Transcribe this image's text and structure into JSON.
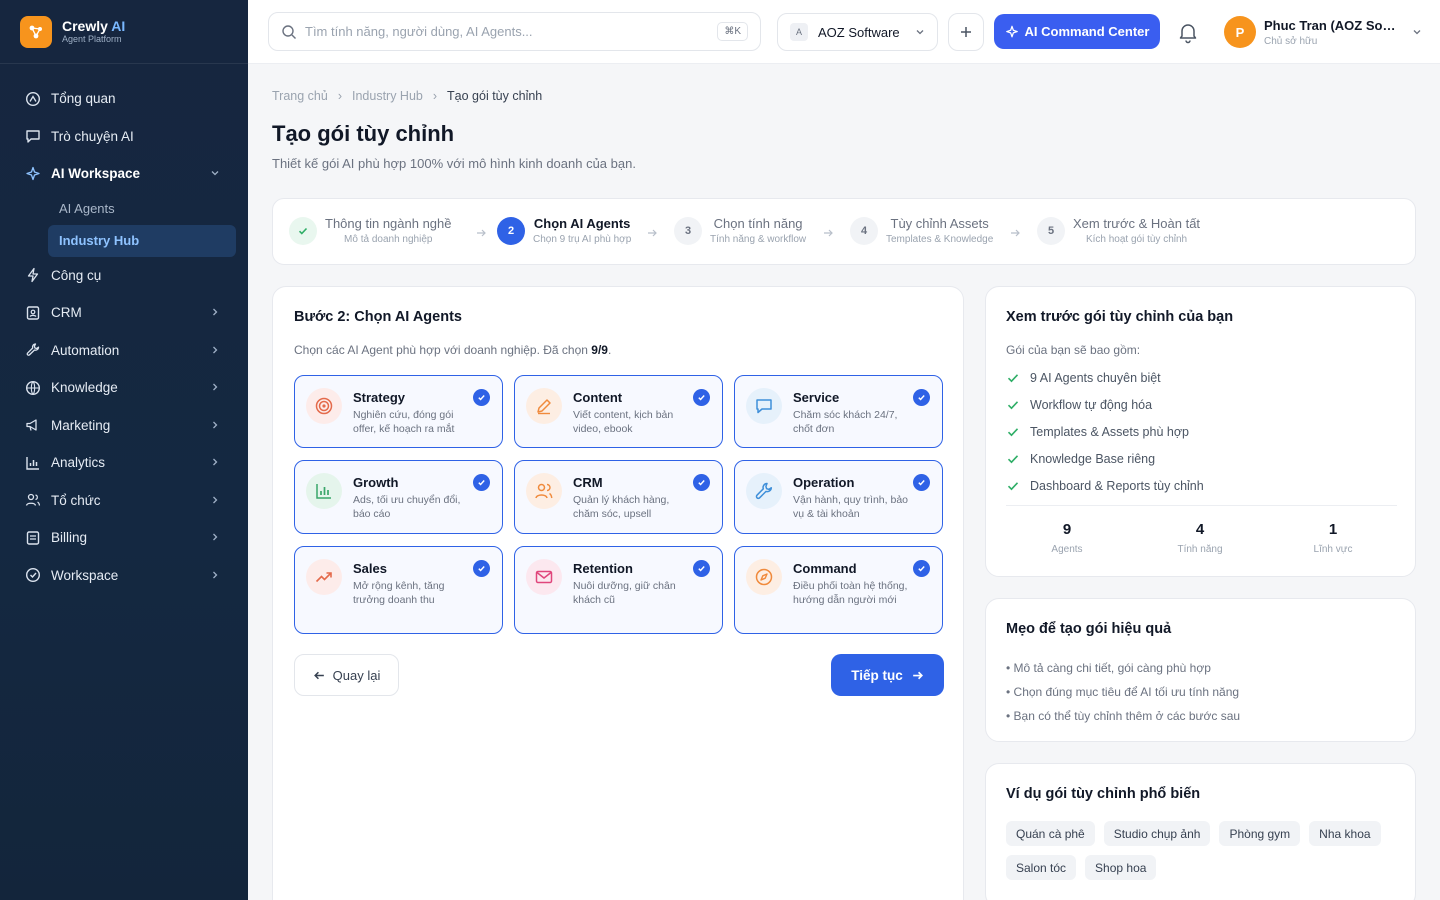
{
  "brand": {
    "name": "Crewly",
    "name_accent": "AI",
    "subtitle": "Agent Platform"
  },
  "sidebar": {
    "items": [
      {
        "label": "Tổng quan",
        "icon": "home-icon"
      },
      {
        "label": "Trò chuyện AI",
        "icon": "chat-icon"
      },
      {
        "label": "AI Workspace",
        "icon": "sparkle-icon"
      },
      {
        "label": "Công cụ",
        "icon": "bolt-icon"
      },
      {
        "label": "CRM",
        "icon": "contact-icon"
      },
      {
        "label": "Automation",
        "icon": "wrench-icon"
      },
      {
        "label": "Knowledge",
        "icon": "globe-icon"
      },
      {
        "label": "Marketing",
        "icon": "megaphone-icon"
      },
      {
        "label": "Analytics",
        "icon": "bar-chart-icon"
      },
      {
        "label": "Tổ chức",
        "icon": "users-icon"
      },
      {
        "label": "Billing",
        "icon": "card-icon"
      },
      {
        "label": "Workspace",
        "icon": "settings-icon"
      }
    ],
    "sub_items": [
      {
        "label": "AI Agents"
      },
      {
        "label": "Industry Hub"
      }
    ]
  },
  "topbar": {
    "search_placeholder": "Tìm tính năng, người dùng, AI Agents...",
    "shortcut": "⌘K",
    "org_initial": "A",
    "org_name": "AOZ Software",
    "command_label": "AI Command Center",
    "user_initial": "P",
    "user_name": "Phuc Tran (AOZ Software)",
    "user_role": "Chủ sở hữu"
  },
  "breadcrumb": [
    "Trang chủ",
    "Industry Hub",
    "Tạo gói tùy chỉnh"
  ],
  "page": {
    "title": "Tạo gói tùy chỉnh",
    "subtitle": "Thiết kế gói AI phù hợp 100% với mô hình kinh doanh của bạn."
  },
  "steps": [
    {
      "num": "✓",
      "title": "Thông tin ngành nghề",
      "sub": "Mô tả doanh nghiệp",
      "state": "done"
    },
    {
      "num": "2",
      "title": "Chọn AI Agents",
      "sub": "Chọn 9 trụ AI phù hợp",
      "state": "current"
    },
    {
      "num": "3",
      "title": "Chọn tính năng",
      "sub": "Tính năng & workflow",
      "state": "todo"
    },
    {
      "num": "4",
      "title": "Tùy chỉnh Assets",
      "sub": "Templates & Knowledge",
      "state": "todo"
    },
    {
      "num": "5",
      "title": "Xem trước & Hoàn tất",
      "sub": "Kích hoạt gói tùy chỉnh",
      "state": "todo"
    }
  ],
  "agents_section": {
    "title": "Bước 2: Chọn AI Agents",
    "hint": "Chọn các AI Agent phù hợp với doanh nghiệp. Đã chọn",
    "selected_count": "9/9",
    "hint_end": ".",
    "agents": [
      {
        "name": "Strategy",
        "desc": "Nghiên cứu, đóng gói offer, kế hoạch ra mắt",
        "icon": "target-icon",
        "color": "#e46a4b",
        "bg": "#fdecea"
      },
      {
        "name": "Content",
        "desc": "Viết content, kịch bản video, ebook",
        "icon": "pen-icon",
        "color": "#f08a3c",
        "bg": "#fdeee3"
      },
      {
        "name": "Service",
        "desc": "Chăm sóc khách 24/7, chốt đơn",
        "icon": "message-icon",
        "color": "#3f8fd9",
        "bg": "#e6f1fb"
      },
      {
        "name": "Growth",
        "desc": "Ads, tối ưu chuyển đổi, báo cáo",
        "icon": "growth-chart-icon",
        "color": "#3aa66a",
        "bg": "#e5f5ec"
      },
      {
        "name": "CRM",
        "desc": "Quản lý khách hàng, chăm sóc, upsell",
        "icon": "people-icon",
        "color": "#f08a3c",
        "bg": "#fdeee3"
      },
      {
        "name": "Operation",
        "desc": "Vận hành, quy trình, bảo vụ & tài khoản",
        "icon": "tool-icon",
        "color": "#3f8fd9",
        "bg": "#e6f1fb"
      },
      {
        "name": "Sales",
        "desc": "Mở rộng kênh, tăng trưởng doanh thu",
        "icon": "trend-up-icon",
        "color": "#e46a4b",
        "bg": "#fdecea"
      },
      {
        "name": "Retention",
        "desc": "Nuôi dưỡng, giữ chân khách cũ",
        "icon": "mail-icon",
        "color": "#e0457b",
        "bg": "#fce8ef"
      },
      {
        "name": "Command",
        "desc": "Điều phối toàn hệ thống, hướng dẫn người mới",
        "icon": "compass-icon",
        "color": "#f08a3c",
        "bg": "#fdeee3"
      }
    ],
    "back_label": "Quay lại",
    "next_label": "Tiếp tục"
  },
  "preview": {
    "title": "Xem trước gói tùy chỉnh của bạn",
    "lead": "Gói của bạn sẽ bao gồm:",
    "items": [
      "9 AI Agents chuyên biệt",
      "Workflow tự động hóa",
      "Templates & Assets phù hợp",
      "Knowledge Base riêng",
      "Dashboard & Reports tùy chỉnh"
    ],
    "stats": [
      {
        "value": "9",
        "label": "Agents"
      },
      {
        "value": "4",
        "label": "Tính năng"
      },
      {
        "value": "1",
        "label": "Lĩnh vực"
      }
    ]
  },
  "tips": {
    "title": "Mẹo để tạo gói hiệu quả",
    "items": [
      "• Mô tả càng chi tiết, gói càng phù hợp",
      "• Chọn đúng mục tiêu để AI tối ưu tính năng",
      "• Bạn có thể tùy chỉnh thêm ở các bước sau"
    ]
  },
  "examples": {
    "title": "Ví dụ gói tùy chỉnh phổ biến",
    "chips": [
      "Quán cà phê",
      "Studio chụp ảnh",
      "Phòng gym",
      "Nha khoa",
      "Salon tóc",
      "Shop hoa"
    ]
  },
  "colors": {
    "primary": "#2f62e6",
    "sidebar": "#16263f",
    "brand_orange": "#f7941d",
    "success": "#2fae67"
  }
}
